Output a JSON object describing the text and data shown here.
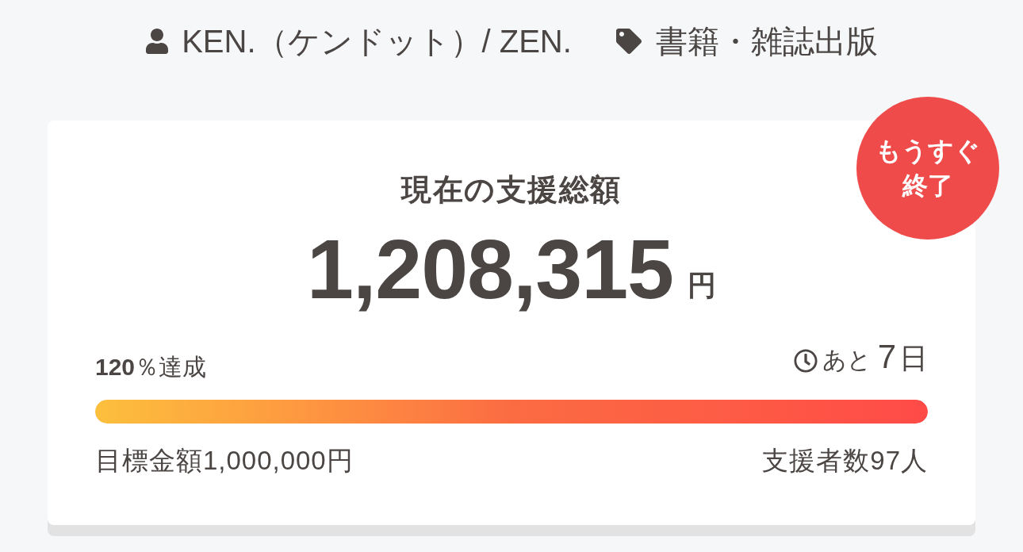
{
  "header": {
    "creator": "KEN.（ケンドット）/ ZEN.",
    "category": "書籍・雑誌出版"
  },
  "card": {
    "badge": {
      "lines": [
        "もうすぐ",
        "終了"
      ]
    },
    "title": "現在の支援総額",
    "amount": {
      "value": "1,208,315",
      "unit": "円"
    },
    "achievement": "**120**％達成",
    "remaining": {
      "prefix": "あと",
      "number": "7",
      "unit": "日"
    },
    "progress": {
      "level": 1
    },
    "goal": "目標金額1,000,000円",
    "backers": "支援者数97人"
  }
}
